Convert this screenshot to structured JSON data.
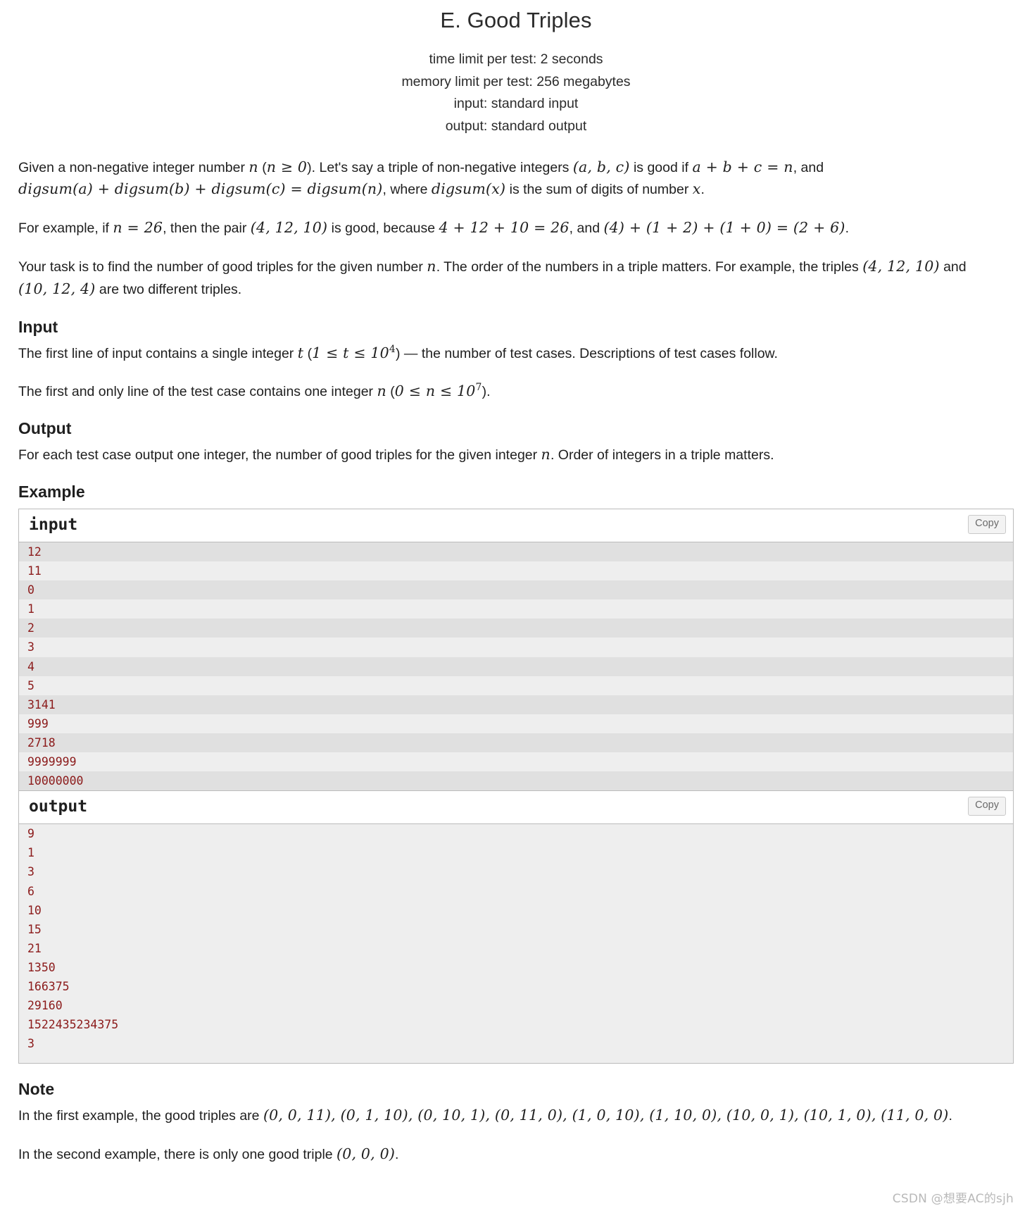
{
  "header": {
    "title": "E. Good Triples",
    "time_limit": "time limit per test: 2 seconds",
    "memory_limit": "memory limit per test: 256 megabytes",
    "input_spec": "input: standard input",
    "output_spec": "output: standard output"
  },
  "statement": {
    "p1_a": "Given a non-negative integer number ",
    "p1_n": "n",
    "p1_b": " (",
    "p1_cond": "n ≥ 0",
    "p1_c": "). Let's say a triple of non-negative integers ",
    "p1_abc": "(a, b, c)",
    "p1_d": " is good if ",
    "p1_eq": "a + b + c = n",
    "p1_e": ", and ",
    "p1_digsum_eq": "digsum(a) + digsum(b) + digsum(c) = digsum(n)",
    "p1_f": ", where ",
    "p1_digsum_x": "digsum(x)",
    "p1_g": " is the sum of digits of number ",
    "p1_x": "x",
    "p1_h": ".",
    "p2_a": "For example, if ",
    "p2_n26": "n = 26",
    "p2_b": ", then the pair ",
    "p2_triple": "(4, 12, 10)",
    "p2_c": " is good, because ",
    "p2_sum": "4 + 12 + 10 = 26",
    "p2_d": ", and ",
    "p2_digsum": "(4) + (1 + 2) + (1 + 0) = (2 + 6)",
    "p2_e": ".",
    "p3_a": "Your task is to find the number of good triples for the given number ",
    "p3_n": "n",
    "p3_b": ". The order of the numbers in a triple matters. For example, the triples ",
    "p3_t1": "(4, 12, 10)",
    "p3_c": " and ",
    "p3_t2": "(10, 12, 4)",
    "p3_d": " are two different triples."
  },
  "input_section": {
    "heading": "Input",
    "line1_a": "The first line of input contains a single integer ",
    "line1_t": "t",
    "line1_b": " (",
    "line1_cond": "1 ≤ t ≤ 10",
    "line1_exp": "4",
    "line1_c": ") — the number of test cases. Descriptions of test cases follow.",
    "line2_a": "The first and only line of the test case contains one integer ",
    "line2_n": "n",
    "line2_b": " (",
    "line2_cond": "0 ≤ n ≤ 10",
    "line2_exp": "7",
    "line2_c": ")."
  },
  "output_section": {
    "heading": "Output",
    "line_a": "For each test case output one integer, the number of good triples for the given integer ",
    "line_n": "n",
    "line_b": ". Order of integers in a triple matters."
  },
  "example_section": {
    "heading": "Example",
    "input_label": "input",
    "output_label": "output",
    "copy_label": "Copy",
    "input_lines": [
      "12",
      "11",
      "0",
      "1",
      "2",
      "3",
      "4",
      "5",
      "3141",
      "999",
      "2718",
      "9999999",
      "10000000"
    ],
    "output_lines": [
      "9",
      "1",
      "3",
      "6",
      "10",
      "15",
      "21",
      "1350",
      "166375",
      "29160",
      "1522435234375",
      "3"
    ]
  },
  "note_section": {
    "heading": "Note",
    "n1_a": "In the first example, the good triples are ",
    "n1_triples": "(0, 0, 11), (0, 1, 10), (0, 10, 1), (0, 11, 0), (1, 0, 10), (1, 10, 0), (10, 0, 1), (10, 1, 0), (11, 0, 0)",
    "n1_b": ".",
    "n2_a": "In the second example, there is only one good triple ",
    "n2_triple": "(0, 0, 0)",
    "n2_b": "."
  },
  "watermark": "CSDN @想要AC的sjh",
  "colors": {
    "sample_text": "#8b1a1a",
    "stripe_dark": "#e0e0e0",
    "stripe_light": "#eeeeee",
    "border": "#bbbbbb"
  }
}
